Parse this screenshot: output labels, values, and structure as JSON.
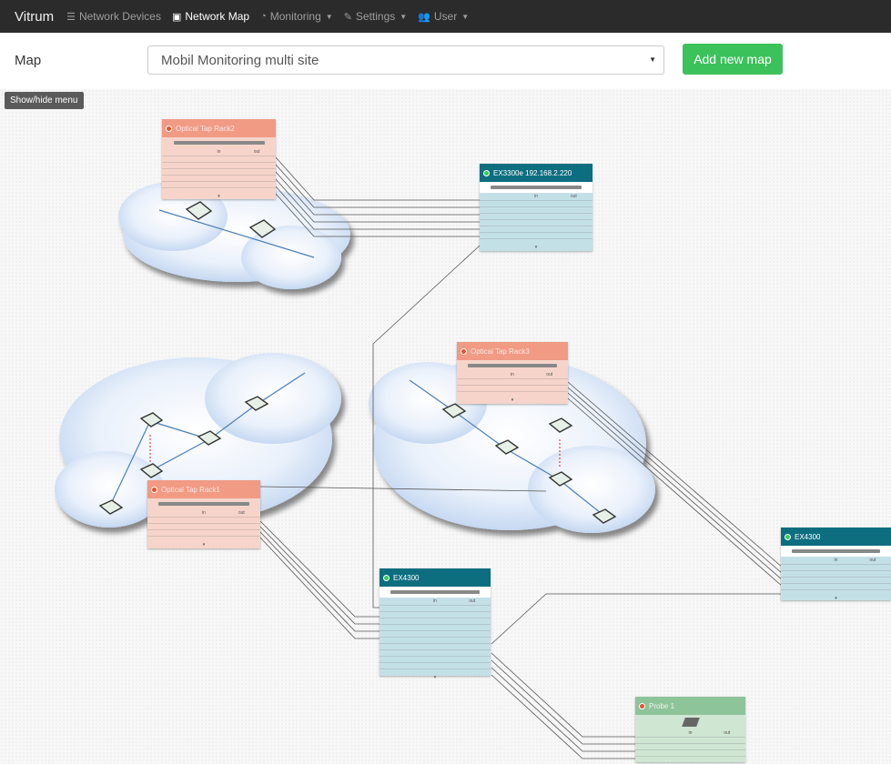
{
  "navbar": {
    "brand": "Vitrum",
    "items": [
      {
        "label": "Network Devices",
        "icon": "list-icon"
      },
      {
        "label": "Network Map",
        "icon": "image-icon"
      },
      {
        "label": "Monitoring",
        "icon": "dashboard-icon"
      },
      {
        "label": "Settings",
        "icon": "wrench-icon"
      },
      {
        "label": "User",
        "icon": "users-icon"
      }
    ]
  },
  "mapbar": {
    "label": "Map",
    "selected_map": "Mobil Monitoring multi site",
    "add_button": "Add new map"
  },
  "canvas": {
    "toggle_menu": "Show/hide menu",
    "devices": [
      {
        "title": "Optical Tap Rack2",
        "status": "red"
      },
      {
        "title": "EX3300e 192.168.2.220",
        "status": "green"
      },
      {
        "title": "Optical Tap Rack3",
        "status": "red"
      },
      {
        "title": "Optical Tap Rack1",
        "status": "red"
      },
      {
        "title": "EX4300",
        "status": "green"
      },
      {
        "title": "EX4300",
        "status": "green"
      },
      {
        "title": "Probe 1",
        "status": "red"
      }
    ],
    "table_headers": {
      "in": "in",
      "out": "out"
    }
  },
  "colors": {
    "navbar_bg": "#2b2b2b",
    "add_button": "#3bc25a",
    "tap_header": "#f19a84",
    "switch_header": "#0d6e80",
    "probe_header": "#8ec49a"
  }
}
